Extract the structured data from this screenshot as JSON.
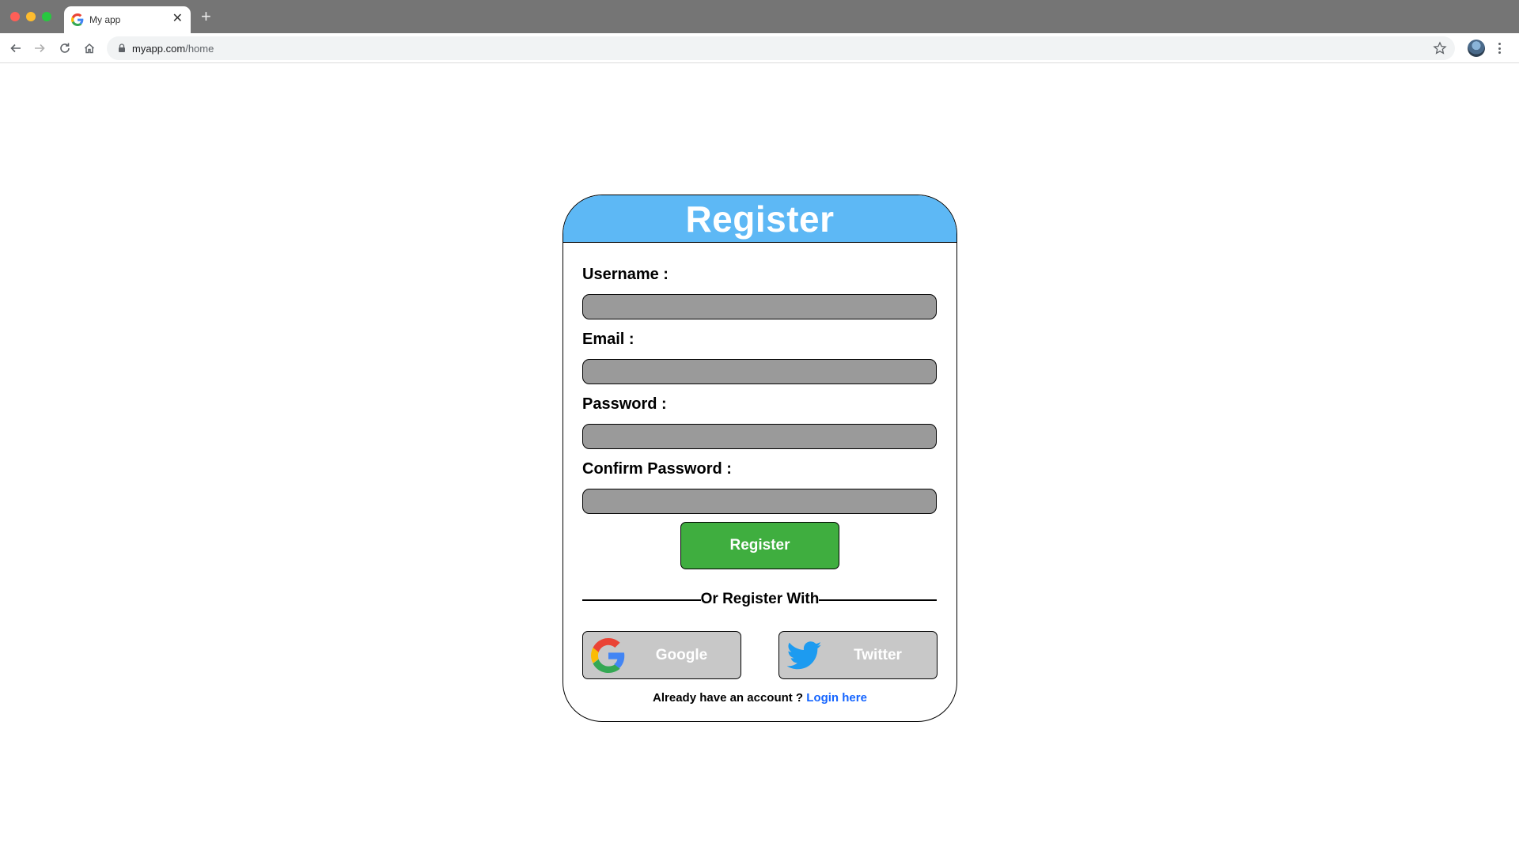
{
  "browser": {
    "tab_title": "My app",
    "tab_close": "✕",
    "new_tab": "+",
    "url_host": "myapp.com",
    "url_path": "/home"
  },
  "register": {
    "title": "Register",
    "fields": [
      {
        "label": "Username :",
        "value": "",
        "placeholder": ""
      },
      {
        "label": "Email :",
        "value": "",
        "placeholder": ""
      },
      {
        "label": "Password :",
        "value": "",
        "placeholder": ""
      },
      {
        "label": "Confirm Password :",
        "value": "",
        "placeholder": ""
      }
    ],
    "submit_label": "Register",
    "divider_text": "Or Register With",
    "social": {
      "google_label": "Google",
      "google_icon": "google-icon",
      "twitter_label": "Twitter",
      "twitter_icon": "twitter-icon"
    },
    "login_prompt": "Already have an account ?",
    "login_link": "Login here"
  },
  "colors": {
    "header": "#5db8f5",
    "input_fill": "#9a9a9a",
    "register_button": "#3fae3f",
    "social_button": "#c8c8c8",
    "link": "#1565ff"
  }
}
